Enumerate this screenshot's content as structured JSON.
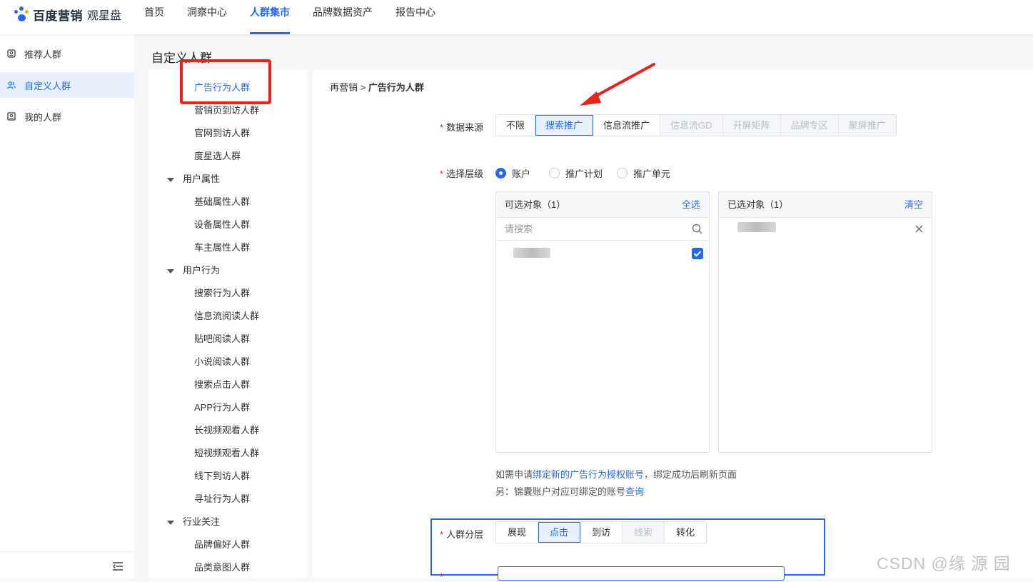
{
  "header": {
    "logo_brand": "百度营销",
    "logo_sub": "观星盘",
    "nav": [
      {
        "label": "首页",
        "active": false
      },
      {
        "label": "洞察中心",
        "active": false
      },
      {
        "label": "人群集市",
        "active": true
      },
      {
        "label": "品牌数据资产",
        "active": false
      },
      {
        "label": "报告中心",
        "active": false
      }
    ]
  },
  "sidebar": {
    "items": [
      {
        "label": "推荐人群",
        "active": false
      },
      {
        "label": "自定义人群",
        "active": true
      },
      {
        "label": "我的人群",
        "active": false
      }
    ],
    "collapse_icon": "menu-fold-icon"
  },
  "page_title": "自定义人群",
  "tree": {
    "items": [
      {
        "type": "item",
        "label": "广告行为人群",
        "active": true
      },
      {
        "type": "item",
        "label": "营销页到访人群"
      },
      {
        "type": "item",
        "label": "官网到访人群"
      },
      {
        "type": "item",
        "label": "度星选人群"
      },
      {
        "type": "group",
        "label": "用户属性"
      },
      {
        "type": "item",
        "label": "基础属性人群"
      },
      {
        "type": "item",
        "label": "设备属性人群"
      },
      {
        "type": "item",
        "label": "车主属性人群"
      },
      {
        "type": "group",
        "label": "用户行为"
      },
      {
        "type": "item",
        "label": "搜索行为人群"
      },
      {
        "type": "item",
        "label": "信息流阅读人群"
      },
      {
        "type": "item",
        "label": "贴吧阅读人群"
      },
      {
        "type": "item",
        "label": "小说阅读人群"
      },
      {
        "type": "item",
        "label": "搜索点击人群"
      },
      {
        "type": "item",
        "label": "APP行为人群"
      },
      {
        "type": "item",
        "label": "长视频观看人群"
      },
      {
        "type": "item",
        "label": "短视频观看人群"
      },
      {
        "type": "item",
        "label": "线下到访人群"
      },
      {
        "type": "item",
        "label": "寻址行为人群"
      },
      {
        "type": "group",
        "label": "行业关注"
      },
      {
        "type": "item",
        "label": "品牌偏好人群"
      },
      {
        "type": "item",
        "label": "品类意图人群"
      }
    ]
  },
  "breadcrumb": {
    "parent": "再营销",
    "sep": ">",
    "current": "广告行为人群"
  },
  "form": {
    "source": {
      "label": "数据来源",
      "options": [
        {
          "label": "不限",
          "state": "normal"
        },
        {
          "label": "搜索推广",
          "state": "on"
        },
        {
          "label": "信息流推广",
          "state": "normal"
        },
        {
          "label": "信息流GD",
          "state": "dis"
        },
        {
          "label": "开屏矩阵",
          "state": "dis"
        },
        {
          "label": "品牌专区",
          "state": "dis"
        },
        {
          "label": "聚屏推广",
          "state": "dis"
        }
      ]
    },
    "level": {
      "label": "选择层级",
      "options": [
        {
          "label": "账户",
          "checked": true
        },
        {
          "label": "推广计划",
          "checked": false
        },
        {
          "label": "推广单元",
          "checked": false
        }
      ]
    },
    "available": {
      "title": "可选对象（1）",
      "action": "全选",
      "search_placeholder": "请搜索"
    },
    "selected": {
      "title": "已选对象（1）",
      "action": "清空"
    },
    "note1": {
      "pre": "如需申请",
      "link": "绑定新的广告行为授权账号",
      "post": "，绑定成功后刷新页面"
    },
    "note2": {
      "pre": "另：锦囊账户对应可绑定的账号",
      "link": "查询"
    },
    "layer": {
      "label": "人群分层",
      "options": [
        {
          "label": "展现",
          "state": "normal"
        },
        {
          "label": "点击",
          "state": "on"
        },
        {
          "label": "到访",
          "state": "normal"
        },
        {
          "label": "线索",
          "state": "dis"
        },
        {
          "label": "转化",
          "state": "normal"
        }
      ]
    }
  },
  "watermark": "CSDN @缘 源 园",
  "colors": {
    "accent": "#2468f2",
    "annotation": "#e8231c"
  }
}
